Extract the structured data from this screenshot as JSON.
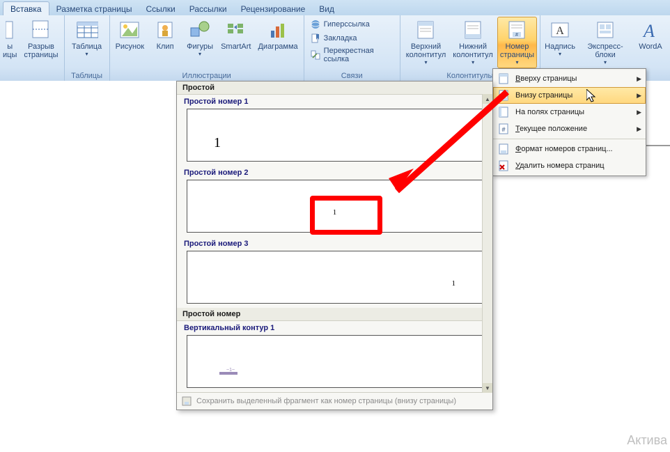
{
  "tabs": {
    "insert": "Вставка",
    "layout": "Разметка страницы",
    "links_tab": "Ссылки",
    "mail": "Рассылки",
    "review": "Рецензирование",
    "view": "Вид"
  },
  "groups": {
    "tables": "Таблицы",
    "illustr": "Иллюстрации",
    "links": "Связи",
    "headfoot": "Колонтитулы"
  },
  "buttons": {
    "page_break": "Разрыв\nстраницы",
    "page_break_side": "ы",
    "table": "Таблица",
    "picture": "Рисунок",
    "clip": "Клип",
    "shapes": "Фигуры",
    "smartart": "SmartArt",
    "chart": "Диаграмма",
    "hyperlink": "Гиперссылка",
    "bookmark": "Закладка",
    "crossref": "Перекрестная ссылка",
    "header": "Верхний\nколонтитул",
    "footer": "Нижний\nколонтитул",
    "pagenum": "Номер\nстраницы",
    "textbox": "Надпись",
    "quickparts": "Экспресс-блоки",
    "wordart": "WordA"
  },
  "submenu": {
    "top": "Вверху страницы",
    "bottom": "Внизу страницы",
    "margins": "На полях страницы",
    "current": "Текущее положение",
    "format": "Формат номеров страниц...",
    "delete": "Удалить номера страниц"
  },
  "gallery": {
    "cat1": "Простой",
    "item1": "Простой номер 1",
    "item2": "Простой номер 2",
    "item3": "Простой номер 3",
    "cat2": "Простой номер",
    "item4": "Вертикальный контур 1",
    "sample": "1",
    "footer_save": "Сохранить выделенный фрагмент как номер страницы (внизу страницы)"
  },
  "watermark": "Актива"
}
